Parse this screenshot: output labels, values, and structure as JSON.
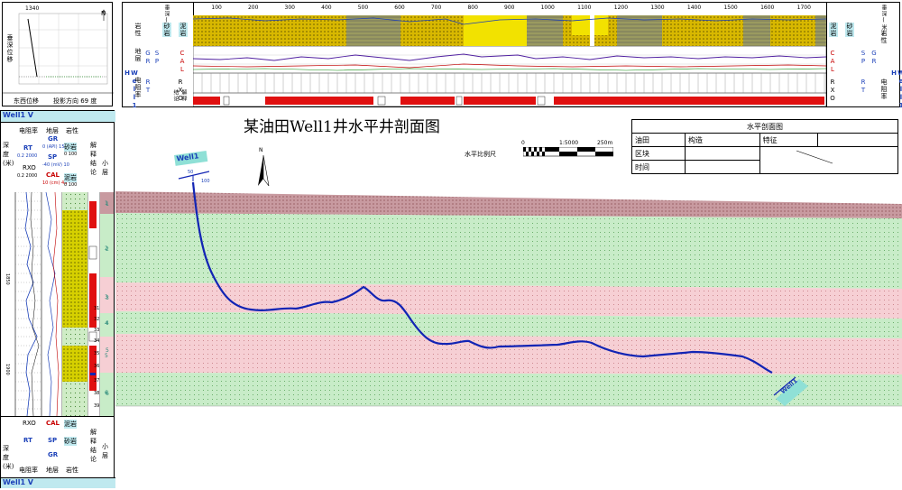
{
  "title": "某油田Well1井水平井剖面图",
  "scale_bar": {
    "label": "水平比例尺",
    "zero": "0",
    "ratio": "1:5000",
    "length": "250m"
  },
  "info_table": {
    "header": "水平剖面图",
    "row1": [
      "油田",
      "构造",
      "特征"
    ],
    "row2": [
      "区块"
    ],
    "row3": [
      "时间"
    ]
  },
  "well_label_top": "Well1",
  "well_label_bottom": "Well1",
  "north_arrow": "N",
  "well_start_marks": {
    "a": "50",
    "b": "100"
  },
  "projection_panel": {
    "ylabel": "垂深位移",
    "xlabel_left": "东西位移",
    "xlabel_right": "投影方向 69 度",
    "top_y": "1340",
    "north": "N"
  },
  "left_panel": {
    "well_name_top": "Well1 V",
    "well_name_bottom": "Well1 V",
    "col_resistivity": "电阻率",
    "col_formation": "地层",
    "col_lithology": "岩性",
    "col_interp": "解释结论",
    "col_layer": "小层",
    "col_depth": "深度(米)",
    "curve_rt": "RT",
    "curve_rxo": "RXO",
    "curve_gr": "GR",
    "curve_sp": "SP",
    "curve_cal": "CAL",
    "lith_sand": "砂岩",
    "lith_mud": "泥岩",
    "range_res": "0.2 2000",
    "range_gr": "0 (API) 150",
    "range_sp": "-40 (mV) 10",
    "range_cal": "10 (cm) 40",
    "range_pct": "0 100",
    "depth_ticks": [
      "1850",
      "1900"
    ],
    "layers": [
      "1",
      "2",
      "3",
      "4",
      "5",
      "6",
      "7",
      "8"
    ],
    "interp_numbers": [
      "31",
      "32",
      "33",
      "34",
      "35",
      "36",
      "37",
      "38",
      "39"
    ]
  },
  "top_panel": {
    "well_name": "Well1 H",
    "row_depth": "垂深(米)",
    "row_lithology": "岩性",
    "row_formation": "地层",
    "row_resistivity": "电阻率",
    "row_interp": "解释结论",
    "curve_gr": "GR",
    "curve_sp": "SP",
    "curve_cal": "CAL",
    "curve_rt": "RT",
    "curve_rxo": "RXO",
    "lith_sand": "砂岩",
    "lith_mud": "泥岩",
    "x_ticks": [
      "100",
      "200",
      "300",
      "400",
      "500",
      "600",
      "700",
      "800",
      "900",
      "1000",
      "1100",
      "1200",
      "1300",
      "1400",
      "1500",
      "1600",
      "1700"
    ]
  },
  "colors": {
    "trajectory": "#1224b4",
    "pink_layer": "#f6cfd4",
    "green_layer": "#c8ecc8",
    "dark_layer": "#c89aa0",
    "well_cyan": "#8fe0d6",
    "sand_yellow": "#e8c800",
    "interp_red": "#e01010"
  },
  "layer_labels": [
    "1",
    "2",
    "3",
    "4",
    "5",
    "6"
  ]
}
